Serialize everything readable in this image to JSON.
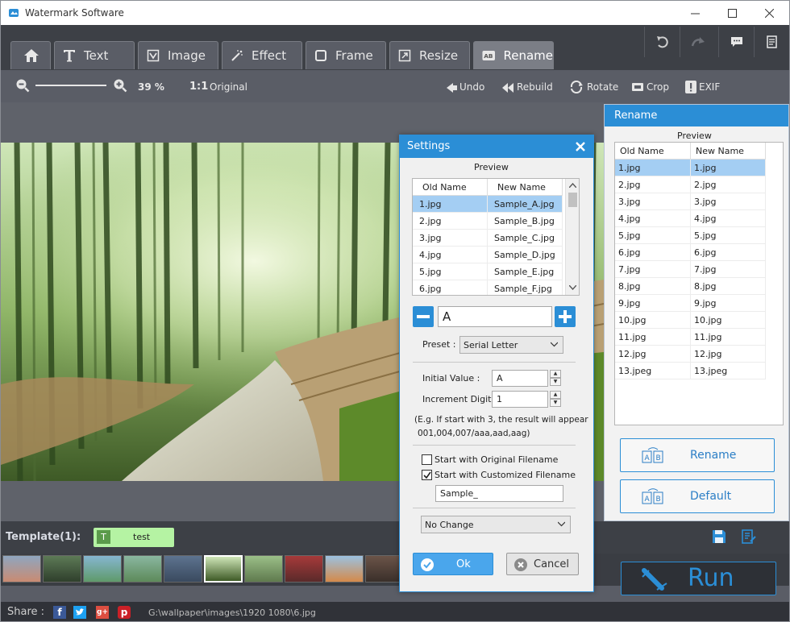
{
  "window": {
    "title": "Watermark Software"
  },
  "tabs": [
    {
      "label": ""
    },
    {
      "label": "Text"
    },
    {
      "label": "Image"
    },
    {
      "label": "Effect"
    },
    {
      "label": "Frame"
    },
    {
      "label": "Resize"
    },
    {
      "label": "Rename"
    }
  ],
  "toolbar": {
    "zoom": "39 %",
    "original": "Original",
    "undo": "Undo",
    "rebuild": "Rebuild",
    "rotate": "Rotate",
    "crop": "Crop",
    "exif": "EXIF"
  },
  "rename_panel": {
    "title": "Rename",
    "preview_label": "Preview",
    "col_old": "Old Name",
    "col_new": "New Name",
    "rows": [
      [
        "1.jpg",
        "1.jpg"
      ],
      [
        "2.jpg",
        "2.jpg"
      ],
      [
        "3.jpg",
        "3.jpg"
      ],
      [
        "4.jpg",
        "4.jpg"
      ],
      [
        "5.jpg",
        "5.jpg"
      ],
      [
        "6.jpg",
        "6.jpg"
      ],
      [
        "7.jpg",
        "7.jpg"
      ],
      [
        "8.jpg",
        "8.jpg"
      ],
      [
        "9.jpg",
        "9.jpg"
      ],
      [
        "10.jpg",
        "10.jpg"
      ],
      [
        "11.jpg",
        "11.jpg"
      ],
      [
        "12.jpg",
        "12.jpg"
      ],
      [
        "13.jpeg",
        "13.jpeg"
      ]
    ],
    "rename_button": "Rename",
    "default_button": "Default"
  },
  "settings": {
    "title": "Settings",
    "preview_label": "Preview",
    "col_old": "Old Name",
    "col_new": "New Name",
    "rows": [
      [
        "1.jpg",
        "Sample_A.jpg"
      ],
      [
        "2.jpg",
        "Sample_B.jpg"
      ],
      [
        "3.jpg",
        "Sample_C.jpg"
      ],
      [
        "4.jpg",
        "Sample_D.jpg"
      ],
      [
        "5.jpg",
        "Sample_E.jpg"
      ],
      [
        "6.jpg",
        "Sample_F.jpg"
      ]
    ],
    "pattern_value": "A",
    "preset_label": "Preset :",
    "preset_value": "Serial Letter",
    "initial_label": "Initial Value :",
    "initial_value": "A",
    "increment_label": "Increment Digit :",
    "increment_value": "1",
    "example_line1": "(E.g. If start with 3, the result will appear",
    "example_line2": "001,004,007/aaa,aad,aag)",
    "opt_original": "Start with Original Filename",
    "opt_custom": "Start with Customized Filename",
    "custom_value": "Sample_",
    "case_value": "No Change",
    "ok": "Ok",
    "cancel": "Cancel"
  },
  "template": {
    "label": "Template(1):",
    "item": "test"
  },
  "run": "Run",
  "share": {
    "label": "Share :",
    "path": "G:\\wallpaper\\images\\1920 1080\\6.jpg"
  },
  "colors": {
    "accent": "#2b8ed6",
    "selection": "#a4cef3",
    "dark": "#3d4046",
    "template": "#b5f3a3"
  }
}
